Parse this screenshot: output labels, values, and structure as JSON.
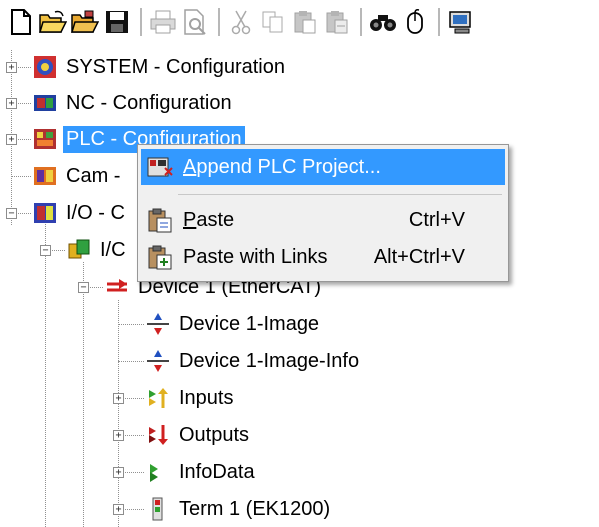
{
  "toolbar": {
    "buttons": [
      "new-icon",
      "open-icon",
      "open-folder-icon",
      "save-icon",
      "print-icon",
      "print-preview-icon",
      "cut-icon",
      "copy-icon",
      "paste-icon",
      "paste-with-links-icon",
      "find-icon",
      "mouse-icon",
      "monitor-icon"
    ]
  },
  "tree": {
    "system": "SYSTEM - Configuration",
    "nc": "NC - Configuration",
    "plc": "PLC - Configuration",
    "cam": "Cam - ",
    "io": "I/O - C",
    "io_devices": "I/C",
    "device1": "Device 1 (EtherCAT)",
    "device1_image": "Device 1-Image",
    "device1_image_info": "Device 1-Image-Info",
    "inputs": "Inputs",
    "outputs": "Outputs",
    "infodata": "InfoData",
    "term1": "Term 1 (EK1200)"
  },
  "context_menu": {
    "append": "Append PLC Project...",
    "paste": "Paste",
    "paste_shortcut": "Ctrl+V",
    "paste_links": "Paste with Links",
    "paste_links_shortcut": "Alt+Ctrl+V"
  },
  "colors": {
    "selection": "#3399ff",
    "menu_bg": "#f0f0f0"
  }
}
